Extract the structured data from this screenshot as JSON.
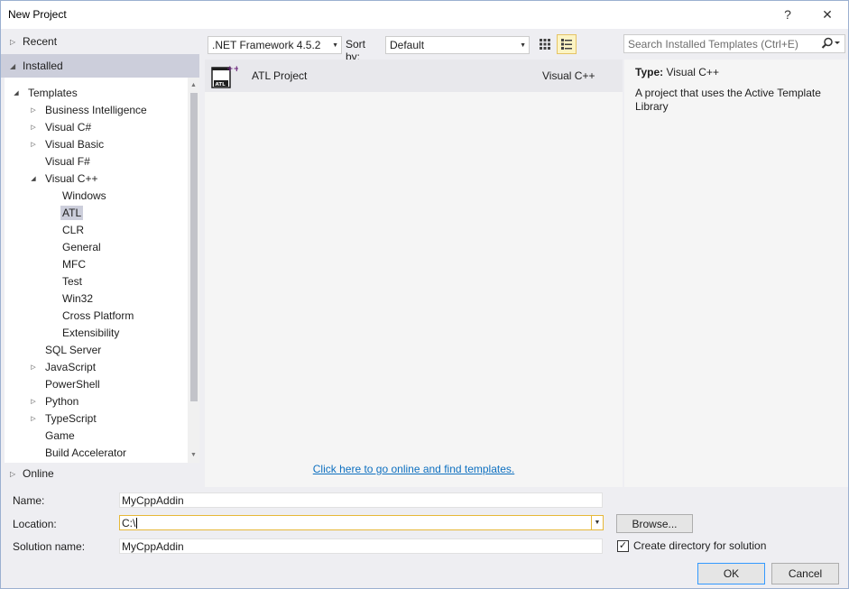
{
  "window": {
    "title": "New Project",
    "help_glyph": "?",
    "close_glyph": "✕"
  },
  "nav": {
    "recent": "Recent",
    "installed": "Installed",
    "online": "Online"
  },
  "tree": [
    {
      "label": "Templates",
      "level": 0,
      "arrow": "expanded"
    },
    {
      "label": "Business Intelligence",
      "level": 1,
      "arrow": "collapsed"
    },
    {
      "label": "Visual C#",
      "level": 1,
      "arrow": "collapsed"
    },
    {
      "label": "Visual Basic",
      "level": 1,
      "arrow": "collapsed"
    },
    {
      "label": "Visual F#",
      "level": 1,
      "arrow": "none"
    },
    {
      "label": "Visual C++",
      "level": 1,
      "arrow": "expanded"
    },
    {
      "label": "Windows",
      "level": 2,
      "arrow": "none"
    },
    {
      "label": "ATL",
      "level": 2,
      "arrow": "none",
      "selected": true
    },
    {
      "label": "CLR",
      "level": 2,
      "arrow": "none"
    },
    {
      "label": "General",
      "level": 2,
      "arrow": "none"
    },
    {
      "label": "MFC",
      "level": 2,
      "arrow": "none"
    },
    {
      "label": "Test",
      "level": 2,
      "arrow": "none"
    },
    {
      "label": "Win32",
      "level": 2,
      "arrow": "none"
    },
    {
      "label": "Cross Platform",
      "level": 2,
      "arrow": "none"
    },
    {
      "label": "Extensibility",
      "level": 2,
      "arrow": "none"
    },
    {
      "label": "SQL Server",
      "level": 1,
      "arrow": "none"
    },
    {
      "label": "JavaScript",
      "level": 1,
      "arrow": "collapsed"
    },
    {
      "label": "PowerShell",
      "level": 1,
      "arrow": "none"
    },
    {
      "label": "Python",
      "level": 1,
      "arrow": "collapsed"
    },
    {
      "label": "TypeScript",
      "level": 1,
      "arrow": "collapsed"
    },
    {
      "label": "Game",
      "level": 1,
      "arrow": "none"
    },
    {
      "label": "Build Accelerator",
      "level": 1,
      "arrow": "none"
    }
  ],
  "toolbar": {
    "framework": ".NET Framework 4.5.2",
    "sort_label": "Sort by:",
    "sort_value": "Default"
  },
  "search": {
    "placeholder": "Search Installed Templates (Ctrl+E)"
  },
  "templates": [
    {
      "name": "ATL Project",
      "language": "Visual C++",
      "icon": "atl-project-icon"
    }
  ],
  "online_link": "Click here to go online and find templates.",
  "details": {
    "type_label": "Type:",
    "type_value": "Visual C++",
    "description": "A project that uses the Active Template Library"
  },
  "form": {
    "name_label": "Name:",
    "name_value": "MyCppAddin",
    "location_label": "Location:",
    "location_value": "C:\\",
    "solution_label": "Solution name:",
    "solution_value": "MyCppAddin",
    "browse": "Browse...",
    "create_dir_label": "Create directory for solution",
    "create_dir_checked": true,
    "ok": "OK",
    "cancel": "Cancel"
  },
  "colors": {
    "selection": "#cccedb",
    "link": "#0e70c0",
    "accent_focus": "#e6b838"
  }
}
